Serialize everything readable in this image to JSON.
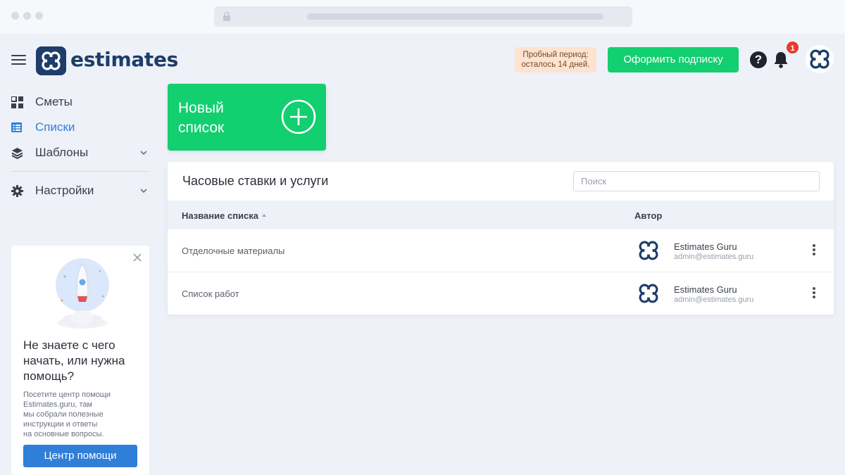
{
  "app": {
    "logo_text": "estimates",
    "trial_notice": "Пробный период:\nосталось 14 дней.",
    "subscribe_label": "Оформить подписку",
    "help_glyph": "?",
    "notification_count": "1"
  },
  "sidebar": {
    "items": [
      {
        "label": "Сметы",
        "icon": "grid-icon"
      },
      {
        "label": "Списки",
        "icon": "list-icon"
      },
      {
        "label": "Шаблоны",
        "icon": "layers-icon"
      },
      {
        "label": "Настройки",
        "icon": "gear-icon"
      }
    ],
    "active_index": 1
  },
  "help_card": {
    "title": "Не знаете с чего начать, или нужна помощь?",
    "text": "Посетите центр помощи\nEstimates.guru, там\nмы собрали полезные\nинструкции и ответы\nна основные вопросы.",
    "button_label": "Центр помощи"
  },
  "new_list": {
    "label": "Новый список"
  },
  "table_card": {
    "title": "Часовые ставки и услуги",
    "search_placeholder": "Поиск",
    "columns": [
      "Название списка",
      "Автор"
    ],
    "rows": [
      {
        "name": "Отделочные материалы",
        "author_name": "Estimates Guru",
        "author_email": "admin@estimates.guru"
      },
      {
        "name": "Список работ",
        "author_name": "Estimates Guru",
        "author_email": "admin@estimates.guru"
      }
    ]
  },
  "colors": {
    "brand": "#1d3d6b",
    "accent_green": "#12cf6f",
    "accent_blue": "#2f7fd9",
    "badge_red": "#e83b2d"
  }
}
